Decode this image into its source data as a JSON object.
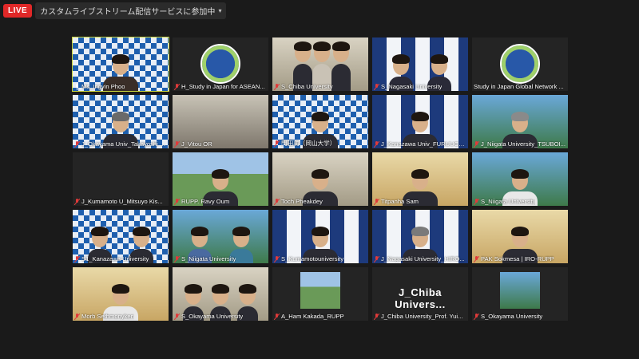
{
  "topbar": {
    "live_label": "LIVE",
    "stream_label": "カスタムライブストリーム配信サービスに参加中",
    "caret": "▾"
  },
  "colors": {
    "live": "#e02828",
    "active_speaker": "#c9d23a",
    "muted_mic": "#e03a3a"
  },
  "participants": [
    {
      "name": "Ms_Ingyin Phoo",
      "muted": false
    },
    {
      "name": "H_Study in Japan for ASEAN...",
      "muted": true
    },
    {
      "name": "S_Chiba University",
      "muted": true
    },
    {
      "name": "S_Nagasaki University",
      "muted": true
    },
    {
      "name": "Study in Japan Global Network ...",
      "muted": false
    },
    {
      "name": "J_Okayama Univ_Takayoshi Suz...",
      "muted": true
    },
    {
      "name": "J_Vitou OR",
      "muted": true
    },
    {
      "name": "門田功（岡山大学）",
      "muted": true
    },
    {
      "name": "J_Kanazawa Univ_FURUUCHI...",
      "muted": true
    },
    {
      "name": "J_Niigata University_TSUBOI...",
      "muted": true
    },
    {
      "name": "J_Kumamoto U_Mitsuyo Kis...",
      "muted": true
    },
    {
      "name": "RUPP. Ravy Oum",
      "muted": true
    },
    {
      "name": "Toch Pheakdey",
      "muted": true
    },
    {
      "name": "Titpanha Sam",
      "muted": true
    },
    {
      "name": "S_Niigata University",
      "muted": true
    },
    {
      "name": "S1_Kanazawa University",
      "muted": true
    },
    {
      "name": "S_Niigata University",
      "muted": true
    },
    {
      "name": "S_Kumamotouniversity",
      "muted": true
    },
    {
      "name": "J_Nagasaki University_HIRO...",
      "muted": true
    },
    {
      "name": "PAK Sokmesa | IRO-RUPP",
      "muted": true
    },
    {
      "name": "Morb Sethmonyken",
      "muted": true
    },
    {
      "name": "S_Okayama University",
      "muted": true
    },
    {
      "name": "A_Ham Kakada_RUPP",
      "muted": true
    },
    {
      "name": "J_Chiba University_Prof. Yui...",
      "muted": true
    },
    {
      "name": "S_Okayama University",
      "muted": true
    }
  ],
  "chiba_tile_text": "J_Chiba Univers..."
}
